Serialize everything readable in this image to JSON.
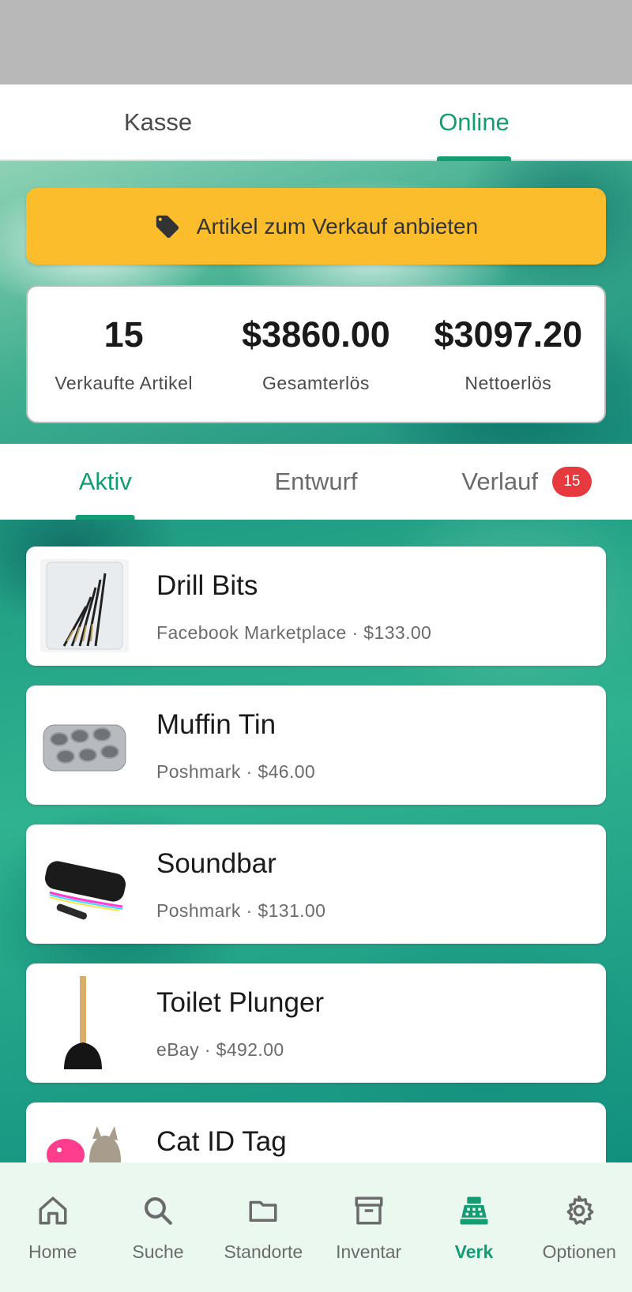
{
  "top_tabs": [
    {
      "label": "Kasse",
      "active": false
    },
    {
      "label": "Online",
      "active": true
    }
  ],
  "sell_button": {
    "label": "Artikel zum Verkauf anbieten",
    "icon": "tag-icon"
  },
  "stats": [
    {
      "value": "15",
      "label": "Verkaufte Artikel"
    },
    {
      "value": "$3860.00",
      "label": "Gesamterlös"
    },
    {
      "value": "$3097.20",
      "label": "Nettoerlös"
    }
  ],
  "sub_tabs": [
    {
      "label": "Aktiv",
      "active": true
    },
    {
      "label": "Entwurf",
      "active": false
    },
    {
      "label": "Verlauf",
      "active": false,
      "badge": "15"
    }
  ],
  "items": [
    {
      "title": "Drill Bits",
      "meta": "Facebook Marketplace · $133.00",
      "image": "drill-bits-image"
    },
    {
      "title": "Muffin Tin",
      "meta": "Poshmark · $46.00",
      "image": "muffin-tin-image"
    },
    {
      "title": "Soundbar",
      "meta": "Poshmark · $131.00",
      "image": "soundbar-image"
    },
    {
      "title": "Toilet Plunger",
      "meta": "eBay · $492.00",
      "image": "toilet-plunger-image"
    },
    {
      "title": "Cat ID Tag",
      "meta": "",
      "image": "cat-id-tag-image"
    }
  ],
  "nav": [
    {
      "label": "Home",
      "icon": "home-icon",
      "active": false
    },
    {
      "label": "Suche",
      "icon": "search-icon",
      "active": false
    },
    {
      "label": "Standorte",
      "icon": "folder-icon",
      "active": false
    },
    {
      "label": "Inventar",
      "icon": "archive-icon",
      "active": false
    },
    {
      "label": "Verk",
      "icon": "cash-register-icon",
      "active": true
    },
    {
      "label": "Optionen",
      "icon": "gear-icon",
      "active": false
    }
  ],
  "colors": {
    "accent": "#139d72",
    "sell_button": "#fbbd2b",
    "badge": "#e63a3f",
    "nav_background": "#eaf8f0"
  }
}
